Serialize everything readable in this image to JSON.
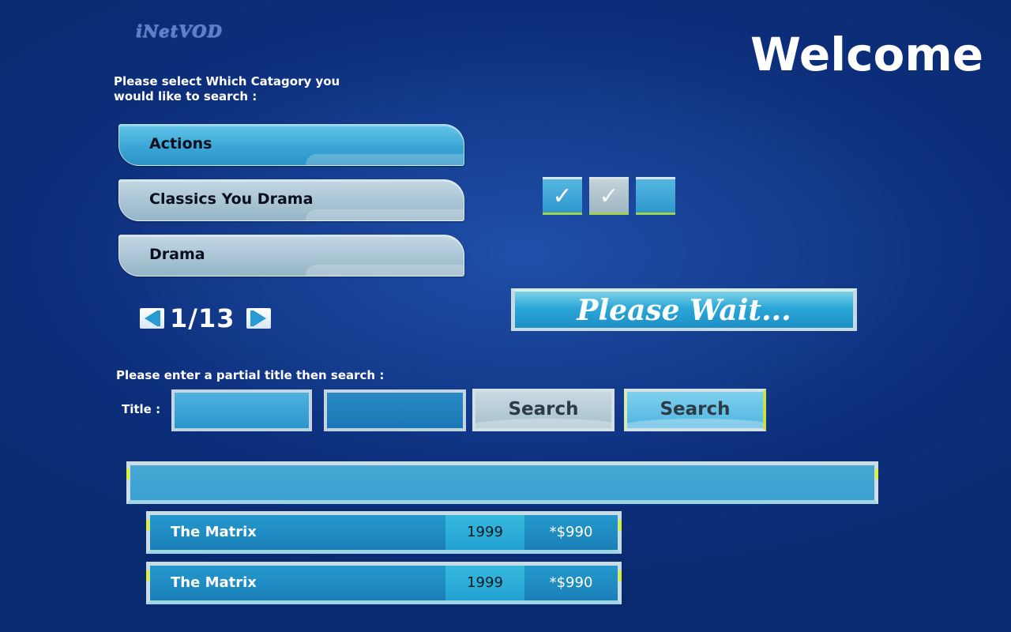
{
  "logo": "iNetVOD",
  "welcome": "Welcome",
  "category_prompt_line1": "Please select Which Catagory you",
  "category_prompt_line2": "would like to search :",
  "categories": [
    {
      "label": "Actions",
      "state": "active"
    },
    {
      "label": "Classics  You Drama",
      "state": "normal"
    },
    {
      "label": "Drama",
      "state": "normal"
    }
  ],
  "checkboxes": [
    {
      "state": "checked",
      "mark": "✓"
    },
    {
      "state": "checked-dim",
      "mark": "✓"
    },
    {
      "state": "unchecked",
      "mark": ""
    }
  ],
  "pager": {
    "text": "1/13"
  },
  "wait_text": "Please Wait...",
  "title_prompt": "Please enter a partial title then search :",
  "title_label": "Title :",
  "title_input": {
    "value": "",
    "placeholder": ""
  },
  "title_input2": {
    "value": "",
    "placeholder": ""
  },
  "search_buttons": [
    "Search",
    "Search"
  ],
  "results_header": "",
  "results": [
    {
      "title": "The Matrix",
      "year": "1999",
      "price": "*$990"
    },
    {
      "title": "The Matrix",
      "year": "1999",
      "price": "*$990"
    }
  ],
  "colors": {
    "background": "#0d2f7c",
    "accent_blue": "#2ba8d8",
    "highlight_green": "#d9ef3a"
  }
}
